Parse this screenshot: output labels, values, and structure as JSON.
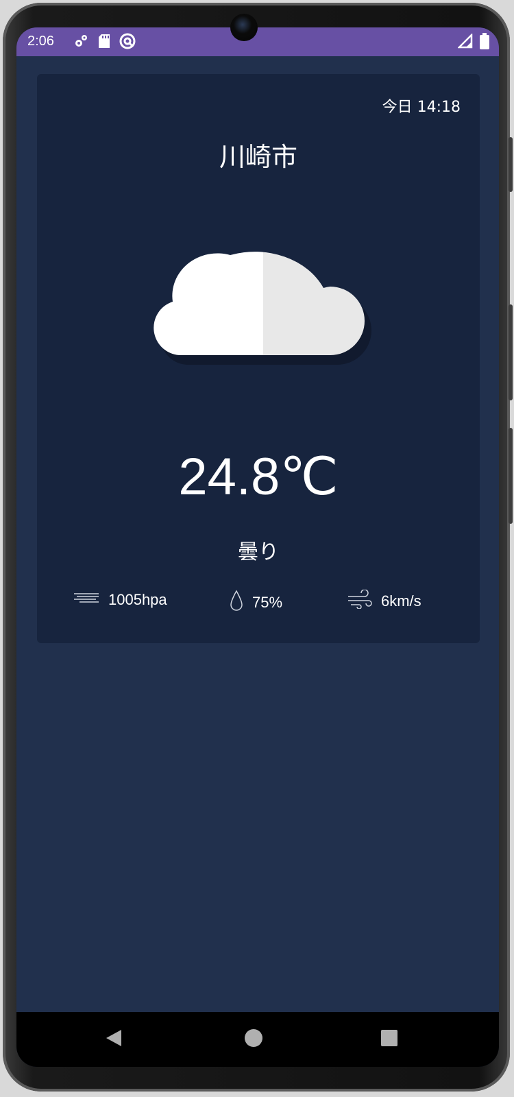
{
  "status_bar": {
    "time": "2:06",
    "left_icons": [
      "settings-icon",
      "sd-card-icon",
      "sync-icon"
    ],
    "right_icons": [
      "signal-icon",
      "battery-icon"
    ],
    "color": "#6750a4"
  },
  "weather": {
    "date_label": "今日 14:18",
    "city": "川崎市",
    "icon": "cloud-icon",
    "temperature": "24.8℃",
    "condition": "曇り",
    "stats": {
      "pressure": "1005hpa",
      "humidity": "75%",
      "wind": "6km/s"
    }
  },
  "nav_bar": {
    "buttons": [
      "back-icon",
      "home-icon",
      "recents-icon"
    ]
  },
  "colors": {
    "background": "#21304d",
    "card": "#17243e",
    "text": "#ffffff"
  }
}
